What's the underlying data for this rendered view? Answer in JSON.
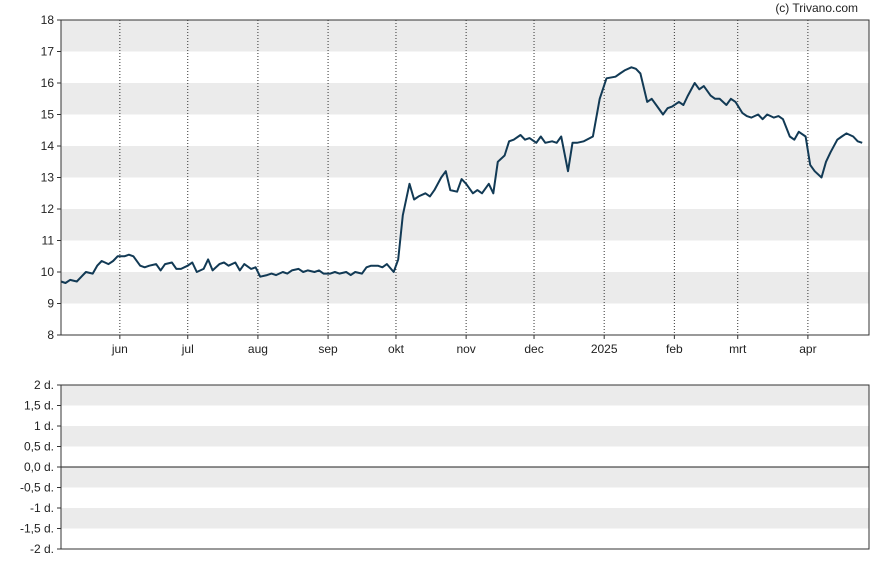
{
  "credit": "(c) Trivano.com",
  "colors": {
    "line": "#123a55",
    "band": "#ebebeb",
    "frame": "#333333",
    "zero_line": "#222222"
  },
  "chart_data": [
    {
      "type": "line",
      "title": "",
      "xlabel": "",
      "ylabel": "",
      "ylim": [
        8,
        18
      ],
      "grid": "alternating horizontal bands, dotted vertical month lines",
      "y_ticks": [
        "8",
        "9",
        "10",
        "11",
        "12",
        "13",
        "14",
        "15",
        "16",
        "17",
        "18"
      ],
      "x_ticks": [
        {
          "label": "jun",
          "date": "2024-06-01"
        },
        {
          "label": "jul",
          "date": "2024-07-01"
        },
        {
          "label": "aug",
          "date": "2024-08-01"
        },
        {
          "label": "sep",
          "date": "2024-09-01"
        },
        {
          "label": "okt",
          "date": "2024-10-01"
        },
        {
          "label": "nov",
          "date": "2024-11-01"
        },
        {
          "label": "dec",
          "date": "2024-12-01"
        },
        {
          "label": "2025",
          "date": "2025-01-01"
        },
        {
          "label": "feb",
          "date": "2025-02-01"
        },
        {
          "label": "mrt",
          "date": "2025-03-01"
        },
        {
          "label": "apr",
          "date": "2025-04-01"
        }
      ],
      "xlim": [
        "2024-05-06",
        "2025-04-28"
      ],
      "series": [
        {
          "points": [
            [
              "2024-05-06",
              9.7
            ],
            [
              "2024-05-08",
              9.65
            ],
            [
              "2024-05-10",
              9.75
            ],
            [
              "2024-05-13",
              9.7
            ],
            [
              "2024-05-15",
              9.85
            ],
            [
              "2024-05-17",
              10.0
            ],
            [
              "2024-05-20",
              9.95
            ],
            [
              "2024-05-22",
              10.2
            ],
            [
              "2024-05-24",
              10.35
            ],
            [
              "2024-05-27",
              10.25
            ],
            [
              "2024-05-29",
              10.35
            ],
            [
              "2024-05-31",
              10.5
            ],
            [
              "2024-06-03",
              10.5
            ],
            [
              "2024-06-05",
              10.55
            ],
            [
              "2024-06-07",
              10.5
            ],
            [
              "2024-06-10",
              10.2
            ],
            [
              "2024-06-12",
              10.15
            ],
            [
              "2024-06-14",
              10.2
            ],
            [
              "2024-06-17",
              10.25
            ],
            [
              "2024-06-19",
              10.05
            ],
            [
              "2024-06-21",
              10.25
            ],
            [
              "2024-06-24",
              10.3
            ],
            [
              "2024-06-26",
              10.1
            ],
            [
              "2024-06-28",
              10.1
            ],
            [
              "2024-07-01",
              10.2
            ],
            [
              "2024-07-03",
              10.3
            ],
            [
              "2024-07-05",
              10.0
            ],
            [
              "2024-07-08",
              10.1
            ],
            [
              "2024-07-10",
              10.4
            ],
            [
              "2024-07-12",
              10.05
            ],
            [
              "2024-07-15",
              10.25
            ],
            [
              "2024-07-17",
              10.3
            ],
            [
              "2024-07-19",
              10.2
            ],
            [
              "2024-07-22",
              10.3
            ],
            [
              "2024-07-24",
              10.05
            ],
            [
              "2024-07-26",
              10.25
            ],
            [
              "2024-07-29",
              10.1
            ],
            [
              "2024-07-31",
              10.15
            ],
            [
              "2024-08-02",
              9.85
            ],
            [
              "2024-08-05",
              9.9
            ],
            [
              "2024-08-07",
              9.95
            ],
            [
              "2024-08-09",
              9.9
            ],
            [
              "2024-08-12",
              10.0
            ],
            [
              "2024-08-14",
              9.95
            ],
            [
              "2024-08-16",
              10.05
            ],
            [
              "2024-08-19",
              10.1
            ],
            [
              "2024-08-21",
              10.0
            ],
            [
              "2024-08-23",
              10.05
            ],
            [
              "2024-08-26",
              10.0
            ],
            [
              "2024-08-28",
              10.05
            ],
            [
              "2024-08-30",
              9.95
            ],
            [
              "2024-09-02",
              9.95
            ],
            [
              "2024-09-04",
              10.0
            ],
            [
              "2024-09-06",
              9.95
            ],
            [
              "2024-09-09",
              10.0
            ],
            [
              "2024-09-11",
              9.9
            ],
            [
              "2024-09-13",
              10.0
            ],
            [
              "2024-09-16",
              9.95
            ],
            [
              "2024-09-18",
              10.15
            ],
            [
              "2024-09-20",
              10.2
            ],
            [
              "2024-09-23",
              10.2
            ],
            [
              "2024-09-25",
              10.15
            ],
            [
              "2024-09-27",
              10.25
            ],
            [
              "2024-09-30",
              10.0
            ],
            [
              "2024-10-02",
              10.4
            ],
            [
              "2024-10-04",
              11.8
            ],
            [
              "2024-10-07",
              12.8
            ],
            [
              "2024-10-09",
              12.3
            ],
            [
              "2024-10-11",
              12.4
            ],
            [
              "2024-10-14",
              12.5
            ],
            [
              "2024-10-16",
              12.4
            ],
            [
              "2024-10-18",
              12.6
            ],
            [
              "2024-10-21",
              13.0
            ],
            [
              "2024-10-23",
              13.2
            ],
            [
              "2024-10-25",
              12.6
            ],
            [
              "2024-10-28",
              12.55
            ],
            [
              "2024-10-30",
              12.95
            ],
            [
              "2024-11-01",
              12.8
            ],
            [
              "2024-11-04",
              12.5
            ],
            [
              "2024-11-06",
              12.6
            ],
            [
              "2024-11-08",
              12.5
            ],
            [
              "2024-11-11",
              12.8
            ],
            [
              "2024-11-13",
              12.5
            ],
            [
              "2024-11-15",
              13.5
            ],
            [
              "2024-11-18",
              13.7
            ],
            [
              "2024-11-20",
              14.15
            ],
            [
              "2024-11-22",
              14.2
            ],
            [
              "2024-11-25",
              14.35
            ],
            [
              "2024-11-27",
              14.2
            ],
            [
              "2024-11-29",
              14.25
            ],
            [
              "2024-12-02",
              14.1
            ],
            [
              "2024-12-04",
              14.3
            ],
            [
              "2024-12-06",
              14.1
            ],
            [
              "2024-12-09",
              14.15
            ],
            [
              "2024-12-11",
              14.1
            ],
            [
              "2024-12-13",
              14.3
            ],
            [
              "2024-12-16",
              13.2
            ],
            [
              "2024-12-18",
              14.1
            ],
            [
              "2024-12-20",
              14.1
            ],
            [
              "2024-12-23",
              14.15
            ],
            [
              "2024-12-27",
              14.3
            ],
            [
              "2024-12-30",
              15.5
            ],
            [
              "2025-01-02",
              16.15
            ],
            [
              "2025-01-06",
              16.2
            ],
            [
              "2025-01-08",
              16.3
            ],
            [
              "2025-01-10",
              16.4
            ],
            [
              "2025-01-13",
              16.5
            ],
            [
              "2025-01-15",
              16.45
            ],
            [
              "2025-01-17",
              16.3
            ],
            [
              "2025-01-20",
              15.4
            ],
            [
              "2025-01-22",
              15.5
            ],
            [
              "2025-01-24",
              15.3
            ],
            [
              "2025-01-27",
              15.0
            ],
            [
              "2025-01-29",
              15.2
            ],
            [
              "2025-01-31",
              15.25
            ],
            [
              "2025-02-03",
              15.4
            ],
            [
              "2025-02-05",
              15.3
            ],
            [
              "2025-02-07",
              15.6
            ],
            [
              "2025-02-10",
              16.0
            ],
            [
              "2025-02-12",
              15.8
            ],
            [
              "2025-02-14",
              15.9
            ],
            [
              "2025-02-17",
              15.6
            ],
            [
              "2025-02-19",
              15.5
            ],
            [
              "2025-02-21",
              15.5
            ],
            [
              "2025-02-24",
              15.3
            ],
            [
              "2025-02-26",
              15.5
            ],
            [
              "2025-02-28",
              15.4
            ],
            [
              "2025-03-03",
              15.05
            ],
            [
              "2025-03-05",
              14.95
            ],
            [
              "2025-03-07",
              14.9
            ],
            [
              "2025-03-10",
              15.0
            ],
            [
              "2025-03-12",
              14.85
            ],
            [
              "2025-03-14",
              15.0
            ],
            [
              "2025-03-17",
              14.9
            ],
            [
              "2025-03-19",
              14.95
            ],
            [
              "2025-03-21",
              14.85
            ],
            [
              "2025-03-24",
              14.3
            ],
            [
              "2025-03-26",
              14.2
            ],
            [
              "2025-03-28",
              14.45
            ],
            [
              "2025-03-31",
              14.3
            ],
            [
              "2025-04-02",
              13.4
            ],
            [
              "2025-04-04",
              13.2
            ],
            [
              "2025-04-07",
              13.0
            ],
            [
              "2025-04-09",
              13.5
            ],
            [
              "2025-04-11",
              13.8
            ],
            [
              "2025-04-14",
              14.2
            ],
            [
              "2025-04-16",
              14.3
            ],
            [
              "2025-04-18",
              14.4
            ],
            [
              "2025-04-21",
              14.3
            ],
            [
              "2025-04-23",
              14.15
            ],
            [
              "2025-04-25",
              14.1
            ]
          ]
        }
      ]
    },
    {
      "type": "line",
      "title": "",
      "xlabel": "",
      "ylabel": "",
      "ylim": [
        -2,
        2
      ],
      "grid": "alternating horizontal bands",
      "y_ticks": [
        "2 d.",
        "1,5 d.",
        "1 d.",
        "0,5 d.",
        "0,0 d.",
        "-0,5 d.",
        "-1 d.",
        "-1,5 d.",
        "-2 d."
      ],
      "series": []
    }
  ]
}
